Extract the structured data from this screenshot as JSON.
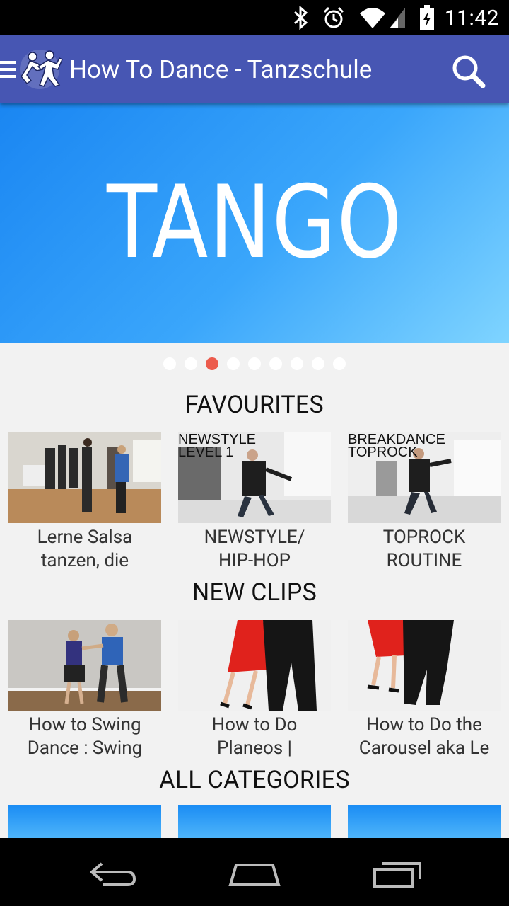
{
  "status_bar": {
    "time": "11:42",
    "icons": [
      "bluetooth-icon",
      "alarm-icon",
      "wifi-icon",
      "signal-icon",
      "battery-icon"
    ]
  },
  "toolbar": {
    "title": "How To Dance - Tanzschule",
    "menu_icon": "hamburger-menu-icon",
    "logo_icon": "dancing-couple-logo-icon",
    "search_icon": "search-icon",
    "color": "#4756b3"
  },
  "hero": {
    "title": "TANGO",
    "page_count": 9,
    "active_index": 2,
    "active_dot_color": "#ec5b4c"
  },
  "favourites": {
    "heading": "FAVOURITES",
    "items": [
      {
        "line1": "Lerne Salsa",
        "line2": "tanzen, die"
      },
      {
        "line1": "NEWSTYLE/",
        "line2": "HIP-HOP",
        "overlay_line1": "NEWSTYLE",
        "overlay_line2": "LEVEL 1"
      },
      {
        "line1": "TOPROCK",
        "line2": "ROUTINE",
        "overlay_line1": "BREAKDANCE",
        "overlay_line2": "TOPROCK"
      }
    ]
  },
  "new_clips": {
    "heading": "NEW CLIPS",
    "items": [
      {
        "line1": "How to Swing",
        "line2": "Dance : Swing"
      },
      {
        "line1": "How to Do",
        "line2": "Planeos |"
      },
      {
        "line1": "How to Do the",
        "line2": "Carousel aka Le"
      }
    ]
  },
  "all_categories": {
    "heading": "ALL CATEGORIES"
  },
  "nav_bar": {
    "buttons": [
      "back-icon",
      "home-icon",
      "recent-apps-icon"
    ]
  }
}
